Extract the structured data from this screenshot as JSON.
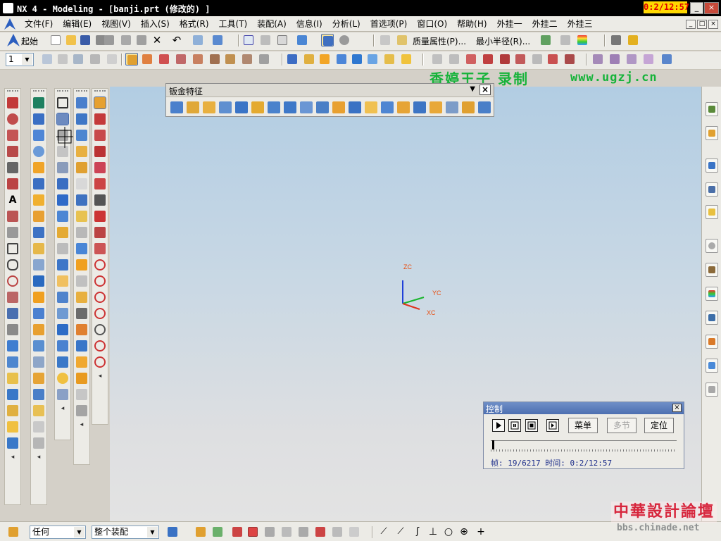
{
  "window": {
    "title": "NX 4 - Modeling - [banji.prt (修改的) ]",
    "clock": "0:2/12:57",
    "buttons": [
      "_",
      "□",
      "×"
    ]
  },
  "menubar": {
    "items": [
      "文件(F)",
      "编辑(E)",
      "视图(V)",
      "插入(S)",
      "格式(R)",
      "工具(T)",
      "装配(A)",
      "信息(I)",
      "分析(L)",
      "首选项(P)",
      "窗口(O)",
      "帮助(H)",
      "外挂一",
      "外挂二",
      "外挂三"
    ],
    "mdi": [
      "_",
      "□",
      "×"
    ]
  },
  "toolbar1": {
    "start_label": "起始",
    "mass_label": "质量属性(P)...",
    "radius_label": "最小半径(R)..."
  },
  "toolbar2": {
    "layer_value": "1"
  },
  "watermark": {
    "line1": "香婷王子 录制",
    "line2": "www.ugzj.cn"
  },
  "sheetmetal": {
    "title": "钣金特征",
    "dropdown": "▼",
    "close": "×"
  },
  "control": {
    "title": "控制",
    "close": "×",
    "buttons": {
      "menu": "菜单",
      "multi": "多节",
      "locate": "定位"
    },
    "status": "帧: 19/6217 时间: 0:2/12:57"
  },
  "axes": {
    "z": "ZC",
    "y": "YC",
    "x": "XC"
  },
  "bottombar": {
    "filter_value": "任何",
    "scope_value": "整个装配"
  },
  "site": {
    "name": "中華設計論壇",
    "url": "bbs.chinade.net"
  },
  "colors": {
    "accent": "#16b33a",
    "viewport_top": "#b2cde3",
    "viewport_bottom": "#e3e3e3",
    "clock_bg": "#ffd800"
  }
}
